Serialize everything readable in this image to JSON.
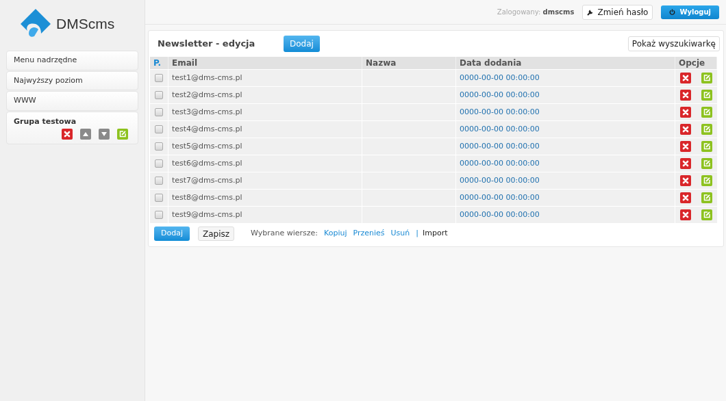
{
  "logo": {
    "text": "DMScms"
  },
  "sidebar": {
    "items": [
      {
        "label": "Menu nadrzędne",
        "selected": false
      },
      {
        "label": "Najwyższy poziom",
        "selected": false
      },
      {
        "label": "WWW",
        "selected": false
      },
      {
        "label": "Grupa testowa",
        "selected": true
      }
    ]
  },
  "topbar": {
    "logged_label": "Zalogowany:",
    "user": "dmscms",
    "change_password": "Zmień hasło",
    "logout": "Wyloguj"
  },
  "panel": {
    "title": "Newsletter - edycja",
    "add_button": "Dodaj",
    "search_toggle": "Pokaż wyszukiwarkę"
  },
  "table": {
    "columns": [
      "P.",
      "Email",
      "Nazwa",
      "Data dodania",
      "Opcje"
    ],
    "rows": [
      {
        "checked": false,
        "email": "test1@dms-cms.pl",
        "date": "0000-00-00 00:00:00"
      },
      {
        "checked": false,
        "email": "test2@dms-cms.pl",
        "date": "0000-00-00 00:00:00"
      },
      {
        "checked": false,
        "email": "test3@dms-cms.pl",
        "date": "0000-00-00 00:00:00"
      },
      {
        "checked": false,
        "email": "test4@dms-cms.pl",
        "date": "0000-00-00 00:00:00"
      },
      {
        "checked": false,
        "email": "test5@dms-cms.pl",
        "date": "0000-00-00 00:00:00"
      },
      {
        "checked": false,
        "email": "test6@dms-cms.pl",
        "date": "0000-00-00 00:00:00"
      },
      {
        "checked": false,
        "email": "test7@dms-cms.pl",
        "date": "0000-00-00 00:00:00"
      },
      {
        "checked": false,
        "email": "test8@dms-cms.pl",
        "date": "0000-00-00 00:00:00"
      },
      {
        "checked": false,
        "email": "test9@dms-cms.pl",
        "date": "0000-00-00 00:00:00"
      }
    ]
  },
  "footer": {
    "add_button": "Dodaj",
    "save_button": "Zapisz",
    "selected_label": "Wybrane wiersze:",
    "links": [
      "Kopiuj",
      "Przenieś",
      "Usuń"
    ],
    "separator": "|",
    "import": "Import"
  }
}
